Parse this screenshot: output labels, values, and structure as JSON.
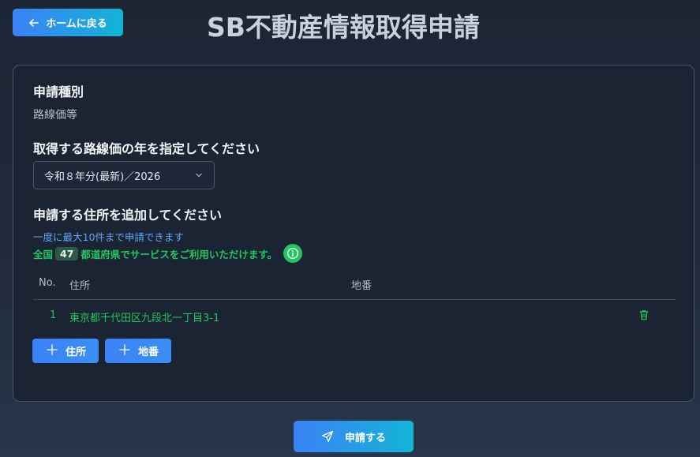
{
  "header": {
    "back_label": "ホームに戻る",
    "title": "SB不動産情報取得申請"
  },
  "application_type": {
    "heading": "申請種別",
    "value": "路線価等"
  },
  "year_select": {
    "heading": "取得する路線価の年を指定してください",
    "selected": "令和８年分(最新)／2026"
  },
  "address": {
    "heading": "申請する住所を追加してください",
    "note_limit": "一度に最大10件まで申請できます",
    "coverage_prefix": "全国",
    "coverage_count": "47",
    "coverage_suffix": "都道府県でサービスをご利用いただけます。",
    "columns": [
      "No.",
      "住所",
      "地番"
    ],
    "rows": [
      {
        "no": "1",
        "address": "東京都千代田区九段北一丁目3-1",
        "lot": ""
      }
    ],
    "add_address_label": "住所",
    "add_lot_label": "地番"
  },
  "submit": {
    "label": "申請する"
  },
  "colors": {
    "accent_blue": "#3b82f6",
    "accent_cyan": "#12b4d6",
    "success_green": "#22c55e",
    "info_blue": "#60a5fa"
  },
  "icons": {
    "back": "arrow-left-icon",
    "select": "chevron-down-icon",
    "info": "info-icon",
    "delete": "trash-icon",
    "add": "plus-icon",
    "submit": "send-icon"
  }
}
